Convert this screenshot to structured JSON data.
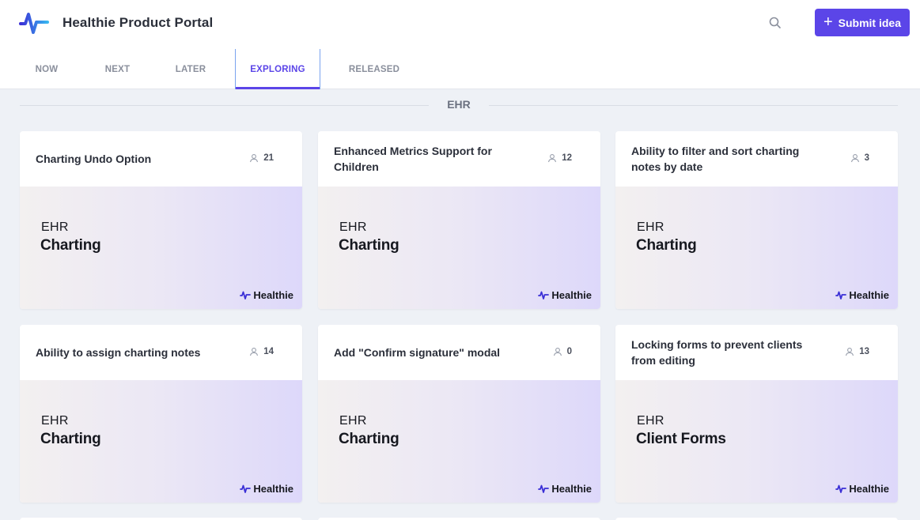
{
  "header": {
    "app_title": "Healthie Product Portal",
    "search_icon": "search-icon",
    "submit_label": "Submit idea",
    "submit_icon": "+"
  },
  "tabs": [
    {
      "label": "NOW",
      "active": false
    },
    {
      "label": "NEXT",
      "active": false
    },
    {
      "label": "LATER",
      "active": false
    },
    {
      "label": "EXPLORING",
      "active": true
    },
    {
      "label": "RELEASED",
      "active": false
    }
  ],
  "section": {
    "title": "EHR"
  },
  "colors": {
    "accent": "#5b45e8",
    "tab_border": "#7aa3ef",
    "background": "#eef1f6"
  },
  "cards": [
    {
      "title": "Charting Undo Option",
      "votes": "21",
      "category": "EHR",
      "subcategory": "Charting",
      "brand": "Healthie"
    },
    {
      "title": "Enhanced Metrics Support for Children",
      "votes": "12",
      "category": "EHR",
      "subcategory": "Charting",
      "brand": "Healthie"
    },
    {
      "title": "Ability to filter and sort charting notes by date",
      "votes": "3",
      "category": "EHR",
      "subcategory": "Charting",
      "brand": "Healthie"
    },
    {
      "title": "Ability to assign charting notes",
      "votes": "14",
      "category": "EHR",
      "subcategory": "Charting",
      "brand": "Healthie"
    },
    {
      "title": "Add \"Confirm signature\" modal",
      "votes": "0",
      "category": "EHR",
      "subcategory": "Charting",
      "brand": "Healthie"
    },
    {
      "title": "Locking forms to prevent clients from editing",
      "votes": "13",
      "category": "EHR",
      "subcategory": "Client Forms",
      "brand": "Healthie"
    }
  ]
}
